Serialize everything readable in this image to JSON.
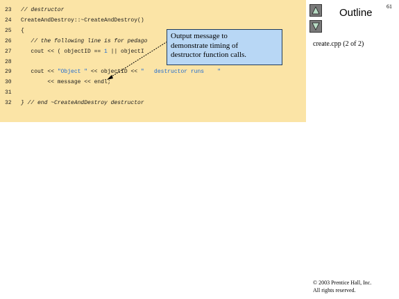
{
  "slide": {
    "page_number": "61",
    "outline_title": "Outline",
    "file_reference": "create.cpp (2 of 2)",
    "copyright_line1": "© 2003 Prentice Hall, Inc.",
    "copyright_line2": "All rights reserved."
  },
  "code": {
    "lines": [
      {
        "number": "23",
        "parts": [
          {
            "text": "// destructor",
            "kind": "comment"
          }
        ]
      },
      {
        "number": "24",
        "parts": [
          {
            "text": "CreateAndDestroy::~CreateAndDestroy()",
            "kind": "code"
          }
        ]
      },
      {
        "number": "25",
        "parts": [
          {
            "text": "{",
            "kind": "code"
          }
        ]
      },
      {
        "number": "26",
        "parts": [
          {
            "text": "   // the following line is for pedago",
            "kind": "comment"
          }
        ]
      },
      {
        "number": "27",
        "parts": [
          {
            "text": "   cout << ( objectID == ",
            "kind": "code"
          },
          {
            "text": "1",
            "kind": "string"
          },
          {
            "text": " || objectI",
            "kind": "code"
          }
        ]
      },
      {
        "number": "28",
        "parts": [
          {
            "text": "",
            "kind": "code"
          }
        ]
      },
      {
        "number": "29",
        "parts": [
          {
            "text": "   cout << ",
            "kind": "code"
          },
          {
            "text": "\"Object \"",
            "kind": "string"
          },
          {
            "text": " << objectID << ",
            "kind": "code"
          },
          {
            "text": "\"   destructor runs    \"",
            "kind": "string"
          }
        ]
      },
      {
        "number": "30",
        "parts": [
          {
            "text": "        << message << endl;",
            "kind": "code"
          }
        ]
      },
      {
        "number": "31",
        "parts": [
          {
            "text": "",
            "kind": "code"
          }
        ]
      },
      {
        "number": "32",
        "parts": [
          {
            "text": "} // end ~CreateAndDestroy destructor",
            "kind": "comment"
          }
        ]
      }
    ]
  },
  "callout": {
    "line1": "Output message to",
    "line2": "demonstrate timing of",
    "line3": "destructor function calls."
  },
  "nav": {
    "up_icon": "triangle-up-icon",
    "down_icon": "triangle-down-icon"
  },
  "colors": {
    "code_background": "#fbe4a6",
    "callout_background": "#b8d7f5",
    "string_color": "#1f6bd1"
  }
}
